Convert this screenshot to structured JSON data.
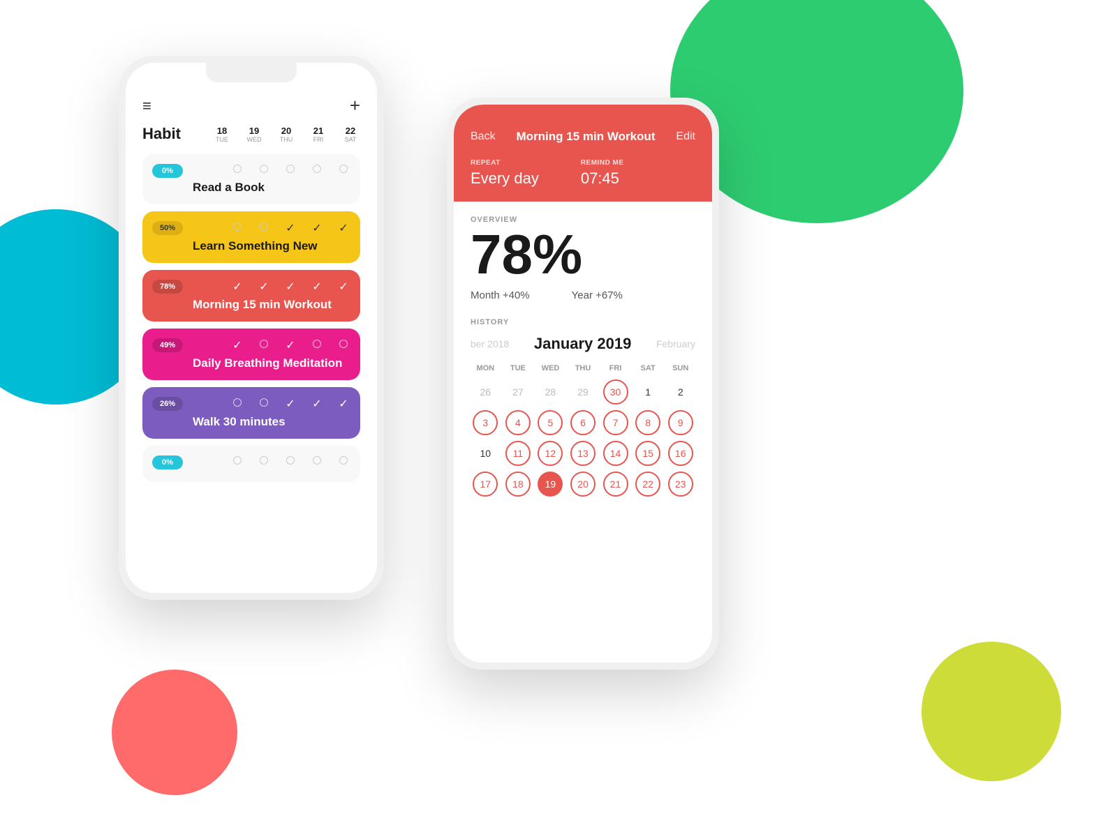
{
  "background": {
    "shapes": [
      "green",
      "cyan",
      "salmon",
      "lime"
    ]
  },
  "phone1": {
    "header": {
      "hamburger": "≡",
      "plus": "+",
      "habit_label": "Habit",
      "dates": [
        {
          "num": "18",
          "day": "TUE"
        },
        {
          "num": "19",
          "day": "WED"
        },
        {
          "num": "20",
          "day": "THU"
        },
        {
          "num": "21",
          "day": "FRI"
        },
        {
          "num": "22",
          "day": "SAT"
        }
      ]
    },
    "habits": [
      {
        "name": "Read a Book",
        "percent": "0%",
        "color": "default",
        "checks": [
          "o",
          "o",
          "o",
          "o",
          "o"
        ]
      },
      {
        "name": "Learn Something New",
        "percent": "50%",
        "color": "yellow",
        "checks": [
          "o",
          "o",
          "✓",
          "✓",
          "✓"
        ]
      },
      {
        "name": "Morning 15 min Workout",
        "percent": "78%",
        "color": "red",
        "checks": [
          "✓",
          "✓",
          "✓",
          "✓",
          "✓"
        ]
      },
      {
        "name": "Daily Breathing Meditation",
        "percent": "49%",
        "color": "pink",
        "checks": [
          "✓",
          "o",
          "✓",
          "o",
          "o"
        ]
      },
      {
        "name": "Walk 30 minutes",
        "percent": "26%",
        "color": "purple",
        "checks": [
          "o",
          "o",
          "✓",
          "✓",
          "✓"
        ]
      },
      {
        "name": "",
        "percent": "0%",
        "color": "default2",
        "checks": [
          "o",
          "o",
          "o",
          "o",
          "o"
        ]
      }
    ]
  },
  "phone2": {
    "nav": {
      "back": "Back",
      "title": "Morning 15 min Workout",
      "edit": "Edit"
    },
    "repeat_label": "REPEAT",
    "repeat_value": "Every day",
    "remind_label": "REMIND ME",
    "remind_value": "07:45",
    "overview_label": "OVERVIEW",
    "overview_percent": "78%",
    "month_stat": "Month +40%",
    "year_stat": "Year +67%",
    "history_label": "HISTORY",
    "calendar": {
      "prev_month": "ber 2018",
      "current_month": "January 2019",
      "next_month": "February",
      "weekdays": [
        "MON",
        "TUE",
        "WED",
        "THU",
        "FRI",
        "SAT",
        "SUN"
      ],
      "weeks": [
        [
          "26",
          "27",
          "28",
          "29",
          "30",
          "1",
          "2"
        ],
        [
          "3",
          "4",
          "5",
          "6",
          "7",
          "8",
          "9"
        ],
        [
          "10",
          "11",
          "12",
          "13",
          "14",
          "15",
          "16"
        ],
        [
          "17",
          "18",
          "19",
          "20",
          "21",
          "22",
          "23"
        ]
      ],
      "circled_dates": [
        "30",
        "3",
        "4",
        "5",
        "6",
        "7",
        "8",
        "9",
        "11",
        "12",
        "13",
        "14",
        "15",
        "16",
        "17",
        "18",
        "20",
        "21",
        "22",
        "23"
      ],
      "filled_dates": [
        "19"
      ]
    }
  }
}
